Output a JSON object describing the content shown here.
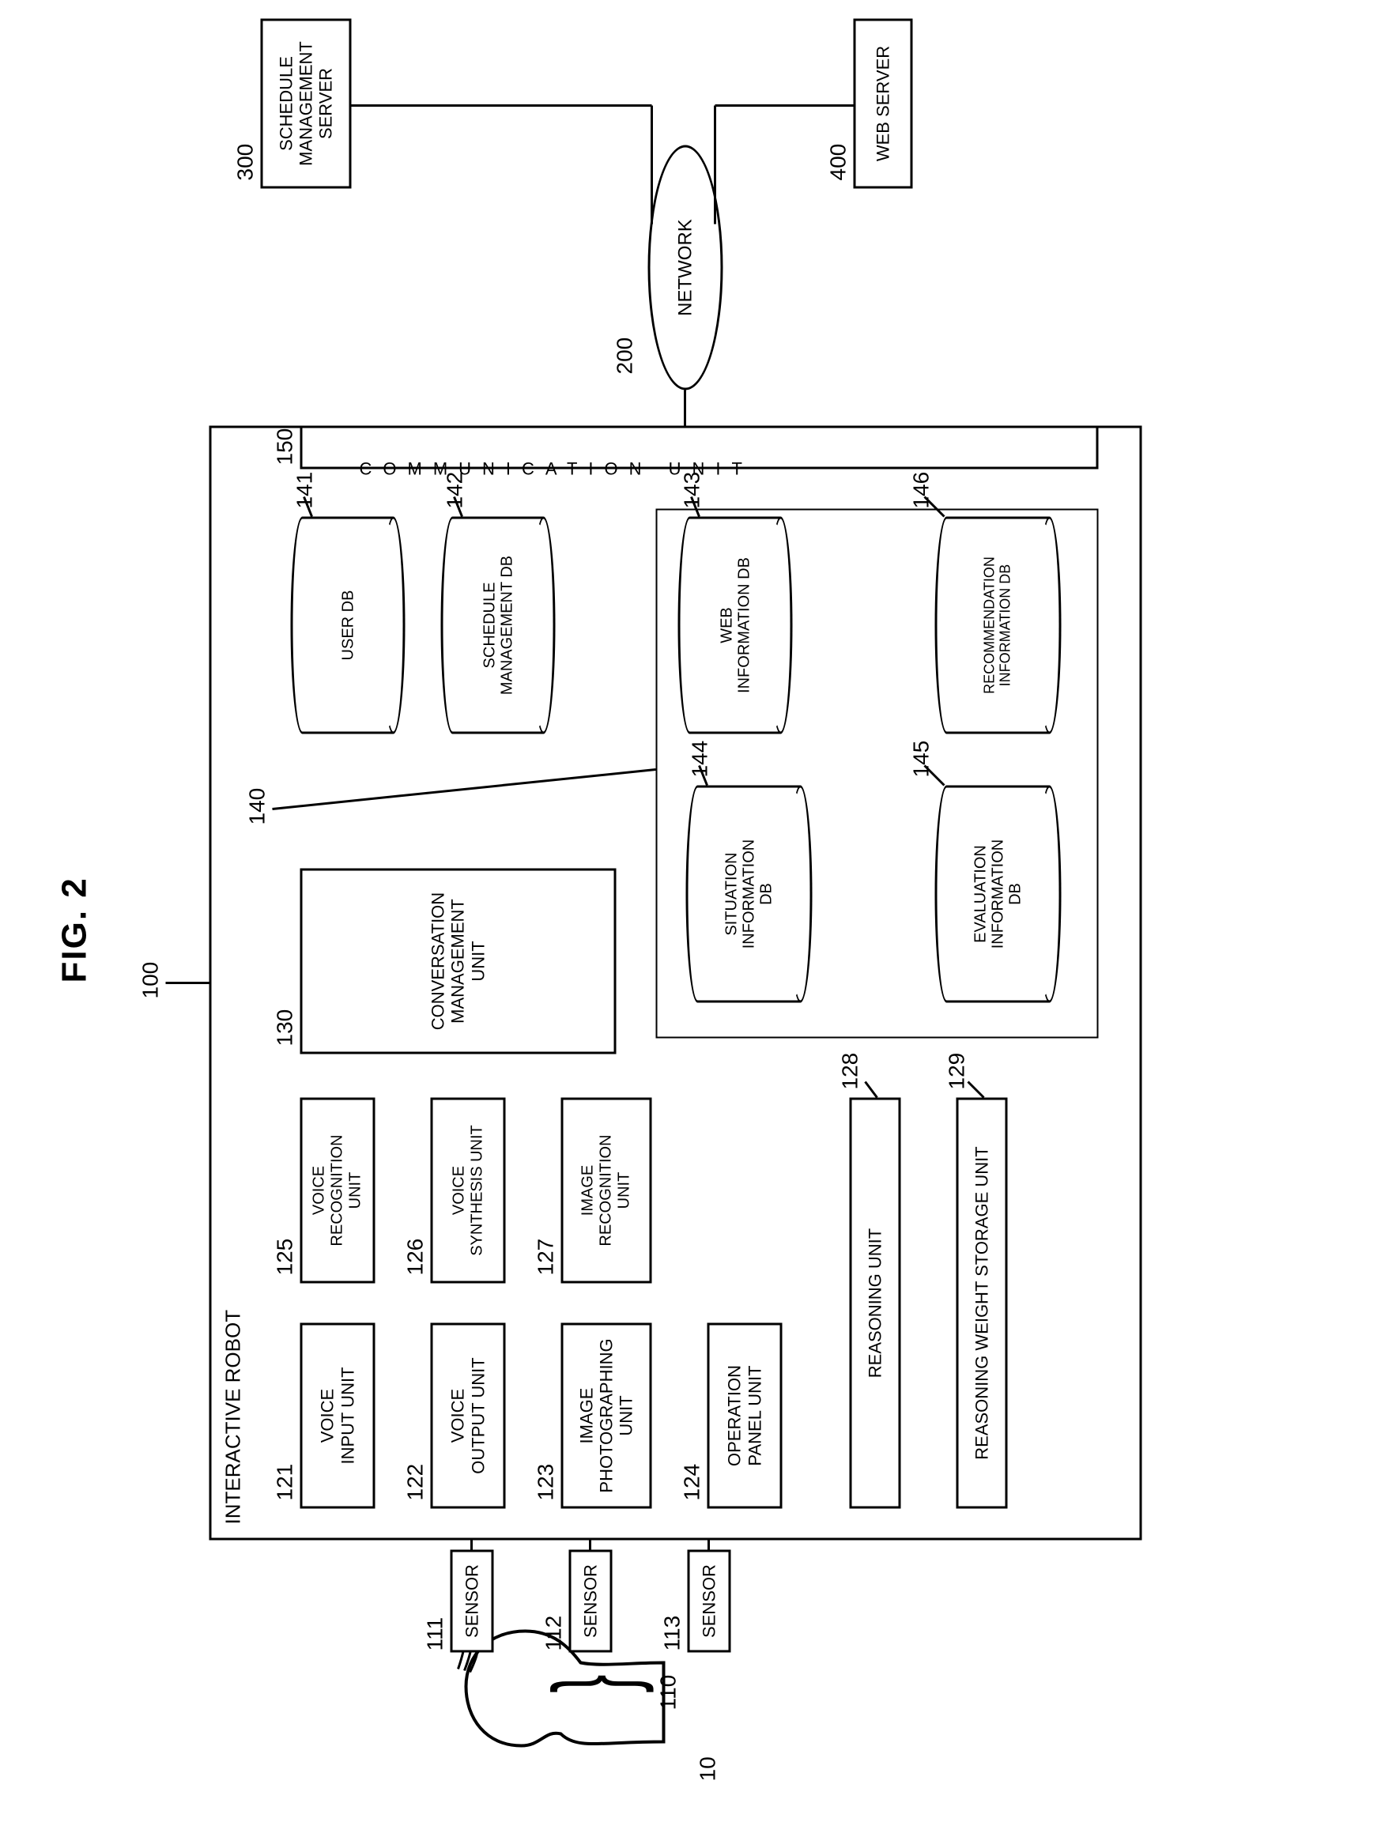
{
  "figure_label": "FIG. 2",
  "refs": {
    "r10": "10",
    "r100": "100",
    "r110": "110",
    "r111": "111",
    "r112": "112",
    "r113": "113",
    "r121": "121",
    "r122": "122",
    "r123": "123",
    "r124": "124",
    "r125": "125",
    "r126": "126",
    "r127": "127",
    "r128": "128",
    "r129": "129",
    "r130": "130",
    "r140": "140",
    "r141": "141",
    "r142": "142",
    "r143": "143",
    "r144": "144",
    "r145": "145",
    "r146": "146",
    "r150": "150",
    "r200": "200",
    "r300": "300",
    "r400": "400"
  },
  "labels": {
    "interactive_robot": "INTERACTIVE ROBOT",
    "sensor": "SENSOR",
    "voice_input": "VOICE\nINPUT UNIT",
    "voice_output": "VOICE\nOUTPUT UNIT",
    "image_photo": "IMAGE\nPHOTOGRAPHING\nUNIT",
    "op_panel": "OPERATION\nPANEL UNIT",
    "voice_recog": "VOICE\nRECOGNITION\nUNIT",
    "voice_synth": "VOICE\nSYNTHESIS UNIT",
    "image_recog": "IMAGE\nRECOGNITION\nUNIT",
    "reasoning": "REASONING UNIT",
    "reasoning_weight": "REASONING WEIGHT STORAGE UNIT",
    "conv_mgmt": "CONVERSATION\nMANAGEMENT\nUNIT",
    "user_db": "USER DB",
    "sched_db": "SCHEDULE\nMANAGEMENT DB",
    "web_db": "WEB\nINFORMATION DB",
    "rec_db": "RECOMMENDATION\nINFORMATION DB",
    "sit_db": "SITUATION\nINFORMATION\nDB",
    "eval_db": "EVALUATION\nINFORMATION\nDB",
    "comm_unit": "COMMUNICATION UNIT",
    "network": "NETWORK",
    "sched_server": "SCHEDULE\nMANAGEMENT\nSERVER",
    "web_server": "WEB SERVER"
  }
}
